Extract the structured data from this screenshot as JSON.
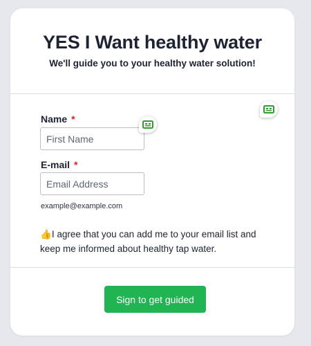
{
  "header": {
    "title": "YES I Want healthy water",
    "subtitle": "We'll guide you to your healthy water solution!"
  },
  "form": {
    "name": {
      "label": "Name",
      "required_mark": "*",
      "placeholder": "First Name",
      "value": ""
    },
    "email": {
      "label": "E-mail",
      "required_mark": "*",
      "placeholder": "Email Address",
      "value": "",
      "hint": "example@example.com"
    },
    "consent": {
      "emoji": "👍",
      "text": "I agree that you can add me to your email list and keep me informed about healthy tap water."
    },
    "submit_label": "Sign to get guided"
  },
  "colors": {
    "accent_green": "#21b453",
    "required_red": "#e01e1e",
    "widget_icon_green": "#2e9e2e"
  },
  "icons": {
    "field_assist": "password-manager-icon"
  }
}
